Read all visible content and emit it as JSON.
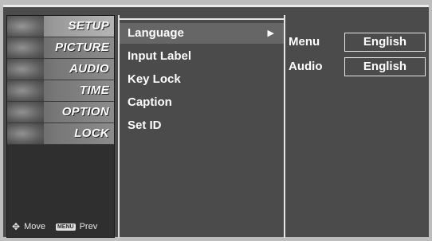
{
  "categories": [
    {
      "label": "SETUP",
      "icon": "setup-thumbnail-icon",
      "selected": true
    },
    {
      "label": "PICTURE",
      "icon": "picture-thumbnail-icon",
      "selected": false
    },
    {
      "label": "AUDIO",
      "icon": "audio-thumbnail-icon",
      "selected": false
    },
    {
      "label": "TIME",
      "icon": "time-thumbnail-icon",
      "selected": false
    },
    {
      "label": "OPTION",
      "icon": "option-thumbnail-icon",
      "selected": false
    },
    {
      "label": "LOCK",
      "icon": "lock-thumbnail-icon",
      "selected": false
    }
  ],
  "nav": {
    "move_label": "Move",
    "menu_key": "MENU",
    "prev_label": "Prev"
  },
  "menu": {
    "items": [
      {
        "label": "Language",
        "selected": true,
        "has_submenu": true
      },
      {
        "label": "Input Label",
        "selected": false
      },
      {
        "label": "Key Lock",
        "selected": false
      },
      {
        "label": "Caption",
        "selected": false
      },
      {
        "label": "Set ID",
        "selected": false
      }
    ],
    "submenu_arrow": "▶"
  },
  "values": [
    {
      "label": "Menu",
      "value": "English"
    },
    {
      "label": "Audio",
      "value": "English"
    }
  ]
}
